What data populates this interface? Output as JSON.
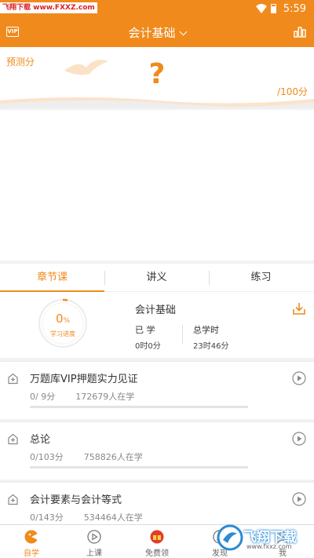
{
  "status_bar": {
    "watermark_text": "飞翔下载 www.FXXZ.com",
    "time": "5:59"
  },
  "header": {
    "vip_label": "VIP",
    "title": "会计基础"
  },
  "prediction": {
    "label": "预测分",
    "value": "?",
    "max": "/100分"
  },
  "tabs": [
    {
      "label": "章节课",
      "active": true
    },
    {
      "label": "讲义",
      "active": false
    },
    {
      "label": "练习",
      "active": false
    }
  ],
  "progress": {
    "percent": "0",
    "percent_unit": "%",
    "caption": "学习进度",
    "subject": "会计基础",
    "learned_label": "已 学",
    "learned_value": "0时0分",
    "total_label": "总学时",
    "total_value": "23时46分"
  },
  "courses": [
    {
      "title": "万题库VIP押题实力见证",
      "score": "0/ 9分",
      "learners": "172679人在学",
      "progress": 0
    },
    {
      "title": "总论",
      "score": "0/103分",
      "learners": "758826人在学",
      "progress": 0
    },
    {
      "title": "会计要素与会计等式",
      "score": "0/143分",
      "learners": "534464人在学",
      "progress": 0
    }
  ],
  "bottom_nav": [
    {
      "label": "自学",
      "icon": "self-study-icon",
      "active": true
    },
    {
      "label": "上课",
      "icon": "play-circle-icon",
      "active": false
    },
    {
      "label": "免费领",
      "icon": "gift-icon",
      "active": false
    },
    {
      "label": "发现",
      "icon": "discover-icon",
      "active": false
    },
    {
      "label": "我",
      "icon": "user-icon",
      "active": false
    }
  ],
  "watermark": {
    "brand": "飞翔下载",
    "url": "www.fxxz.com"
  },
  "colors": {
    "accent": "#f08a1d",
    "background": "#f2f2f2"
  }
}
